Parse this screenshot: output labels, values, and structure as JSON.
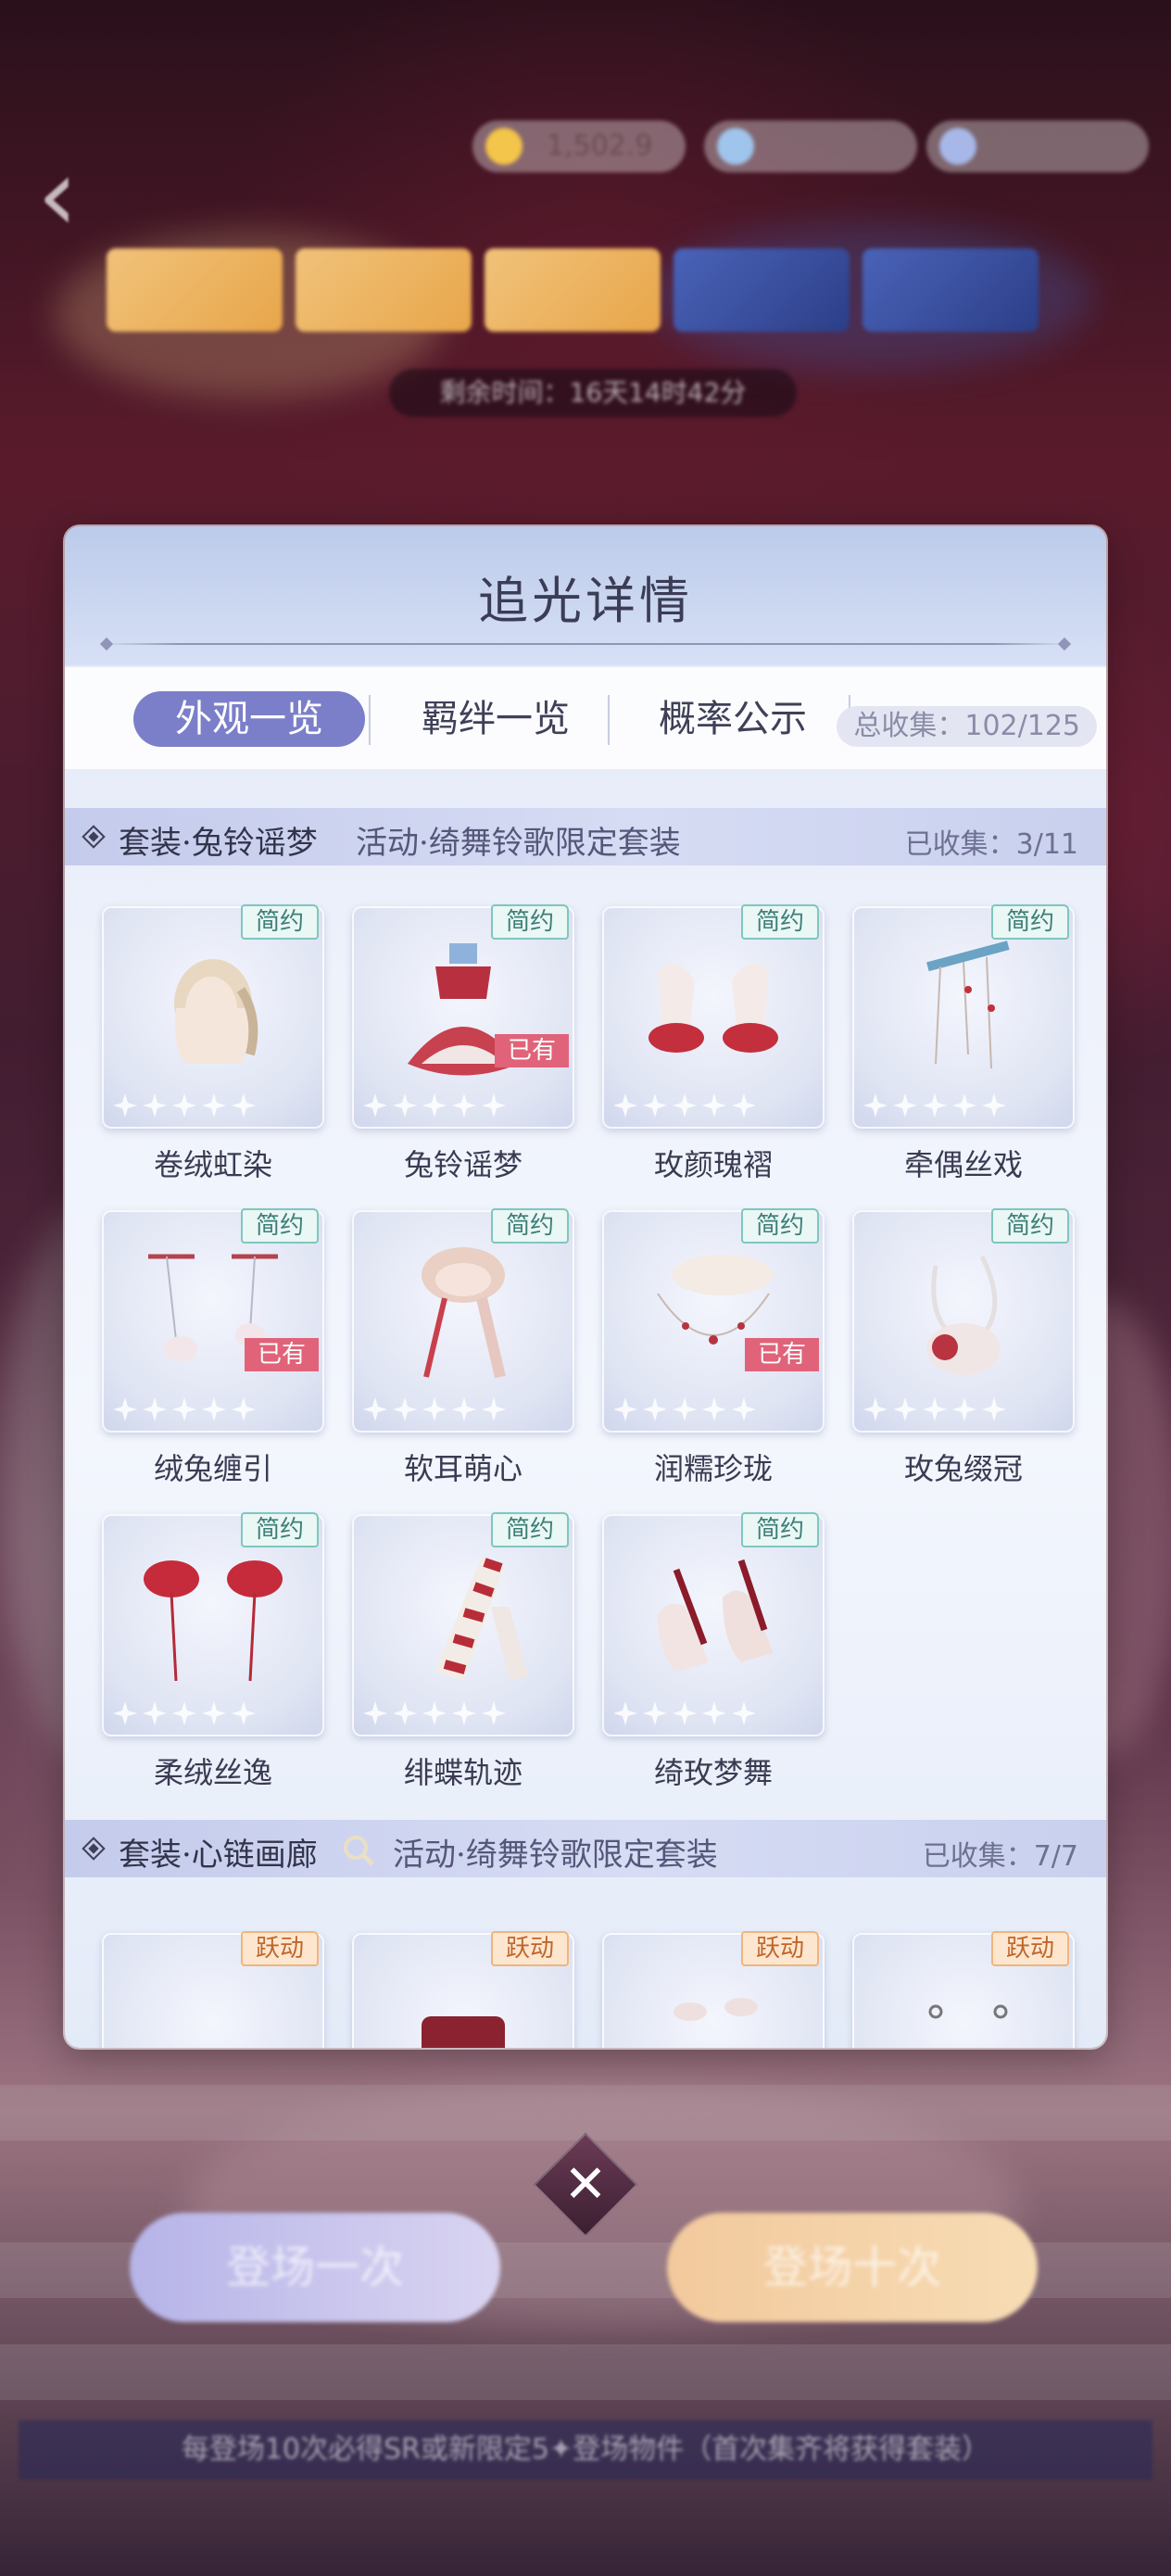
{
  "hud": {
    "currency_1": "1,502.9",
    "timer": "剩余时间：16天14时42分",
    "banners": [
      "",
      "",
      "",
      "",
      ""
    ]
  },
  "modal": {
    "title": "追光详情",
    "tabs": [
      {
        "label": "外观一览",
        "active": true
      },
      {
        "label": "羁绊一览",
        "active": false
      },
      {
        "label": "概率公示",
        "active": false
      }
    ],
    "total_collected": "总收集：102/125"
  },
  "section1": {
    "title": "套装·兔铃谣梦",
    "subtitle": "活动·绮舞铃歌限定套装",
    "count": "已收集：3/11",
    "items": [
      {
        "name": "卷绒虹染",
        "tag": "简约",
        "owned": "",
        "stars": 5
      },
      {
        "name": "兔铃谣梦",
        "tag": "简约",
        "owned": "已有",
        "stars": 5
      },
      {
        "name": "玫颜瑰褶",
        "tag": "简约",
        "owned": "",
        "stars": 5
      },
      {
        "name": "牵偶丝戏",
        "tag": "简约",
        "owned": "",
        "stars": 5
      },
      {
        "name": "绒兔缠引",
        "tag": "简约",
        "owned": "已有",
        "stars": 5
      },
      {
        "name": "软耳萌心",
        "tag": "简约",
        "owned": "",
        "stars": 5
      },
      {
        "name": "润糯珍珑",
        "tag": "简约",
        "owned": "已有",
        "stars": 5
      },
      {
        "name": "玫兔缀冠",
        "tag": "简约",
        "owned": "",
        "stars": 5
      },
      {
        "name": "柔绒丝逸",
        "tag": "简约",
        "owned": "",
        "stars": 5
      },
      {
        "name": "绯蝶轨迹",
        "tag": "简约",
        "owned": "",
        "stars": 5
      },
      {
        "name": "绮玫梦舞",
        "tag": "简约",
        "owned": "",
        "stars": 5
      }
    ]
  },
  "section2": {
    "title": "套装·心链画廊",
    "subtitle": "活动·绮舞铃歌限定套装",
    "count": "已收集：7/7",
    "items": [
      {
        "tag": "跃动"
      },
      {
        "tag": "跃动"
      },
      {
        "tag": "跃动"
      },
      {
        "tag": "跃动"
      }
    ]
  },
  "buttons": {
    "close": "✕",
    "draw_one": "登场一次",
    "draw_ten": "登场十次"
  },
  "bottom_notice": "每登场10次必得SR或新限定5✦登场物件（首次集齐将获得套装）",
  "colors": {
    "tab_active": "#7b7fc9",
    "owned_badge": "#e0637a",
    "tag_simple": "#7fc7bd",
    "tag_active": "#f0b57c"
  }
}
